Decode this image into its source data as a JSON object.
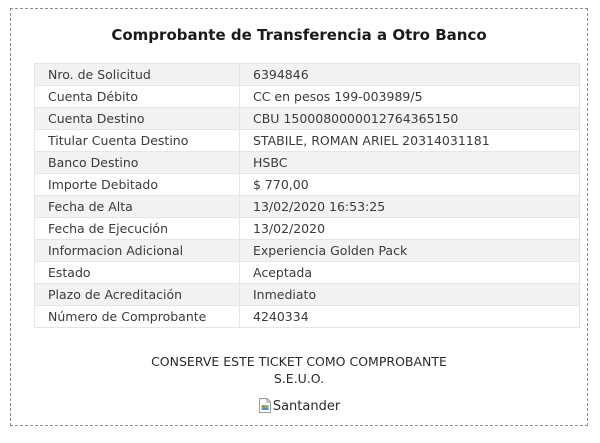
{
  "receipt": {
    "title": "Comprobante de Transferencia a Otro Banco",
    "rows": [
      {
        "label": "Nro. de Solicitud",
        "value": "6394846"
      },
      {
        "label": "Cuenta Débito",
        "value": "CC en pesos 199-003989/5"
      },
      {
        "label": "Cuenta Destino",
        "value": "CBU 1500080000012764365150"
      },
      {
        "label": "Titular Cuenta Destino",
        "value": "STABILE, ROMAN ARIEL 20314031181"
      },
      {
        "label": "Banco Destino",
        "value": "HSBC"
      },
      {
        "label": "Importe Debitado",
        "value": "$ 770,00"
      },
      {
        "label": "Fecha de Alta",
        "value": "13/02/2020 16:53:25"
      },
      {
        "label": "Fecha de Ejecución",
        "value": "13/02/2020"
      },
      {
        "label": "Informacion Adicional",
        "value": "Experiencia Golden Pack"
      },
      {
        "label": "Estado",
        "value": "Aceptada"
      },
      {
        "label": "Plazo de Acreditación",
        "value": "Inmediato"
      },
      {
        "label": "Número de Comprobante",
        "value": "4240334"
      }
    ],
    "notice_line1": "CONSERVE ESTE TICKET COMO COMPROBANTE",
    "notice_line2": "S.E.U.O.",
    "logo_alt": "Santander",
    "logo_icon": "broken-image-icon"
  }
}
